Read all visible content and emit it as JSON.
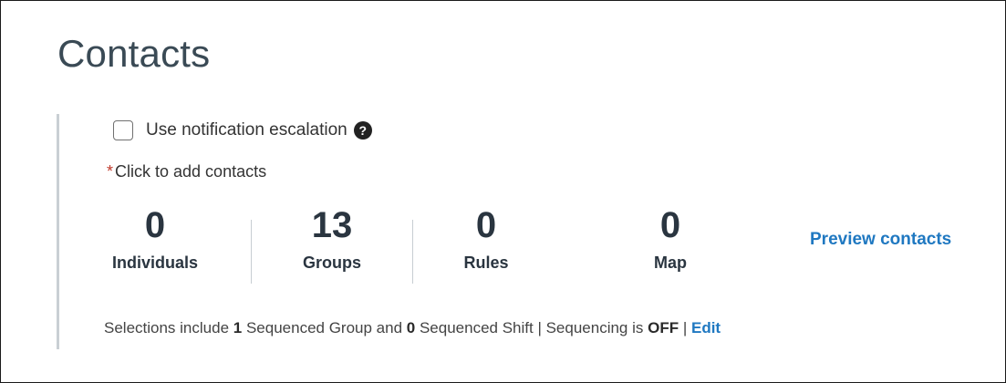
{
  "page": {
    "title": "Contacts"
  },
  "escalation": {
    "label": "Use notification escalation",
    "checked": false
  },
  "add_contacts": {
    "required_mark": "*",
    "text": "Click to add contacts"
  },
  "stats": [
    {
      "count": "0",
      "label": "Individuals"
    },
    {
      "count": "13",
      "label": "Groups"
    },
    {
      "count": "0",
      "label": "Rules"
    },
    {
      "count": "0",
      "label": "Map"
    }
  ],
  "preview_link": "Preview contacts",
  "summary": {
    "prefix": "Selections include ",
    "group_count": "1",
    "group_text": " Sequenced Group and ",
    "shift_count": "0",
    "shift_text": " Sequenced Shift | Sequencing is ",
    "state": "OFF",
    "separator": " | ",
    "edit_label": "Edit"
  },
  "colors": {
    "link": "#1f78c1",
    "required": "#c0392b",
    "title": "#3a4a55"
  }
}
